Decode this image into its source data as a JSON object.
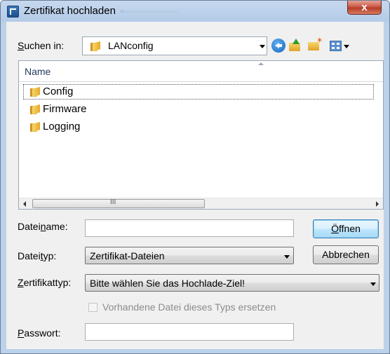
{
  "window": {
    "title": "Zertifikat hochladen",
    "title_suffix": "~················",
    "close_label": "x"
  },
  "lookin": {
    "label_prefix": "S",
    "label_rest": "uchen in:",
    "value": "LANconfig"
  },
  "toolbar": {
    "icons": [
      "back-icon",
      "up-folder-icon",
      "new-folder-icon",
      "view-menu-icon"
    ]
  },
  "filelist": {
    "column_name": "Name",
    "items": [
      {
        "name": "Config",
        "icon": "folder-icon"
      },
      {
        "name": "Firmware",
        "icon": "folder-icon"
      },
      {
        "name": "Logging",
        "icon": "folder-icon"
      }
    ],
    "scroll_grip": "III"
  },
  "form": {
    "filename_label_a": "Datei",
    "filename_label_u": "n",
    "filename_label_b": "ame:",
    "filename_value": "",
    "filetype_label_a": "Datei",
    "filetype_label_u": "t",
    "filetype_label_b": "yp:",
    "filetype_value": "Zertifikat-Dateien",
    "certtype_label_u": "Z",
    "certtype_label_b": "ertifikattyp:",
    "certtype_value": "Bitte wählen Sie das Hochlade-Ziel!",
    "replace_label": "Vorhandene Datei dieses Typs ersetzen",
    "password_label_u": "P",
    "password_label_b": "asswort:",
    "password_value": ""
  },
  "buttons": {
    "open_u": "Ö",
    "open_rest": "ffnen",
    "cancel": "Abbrechen"
  },
  "colors": {
    "titlebar": "#bcd1ea",
    "close": "#c8523f",
    "default_button": "#bee6fd"
  }
}
